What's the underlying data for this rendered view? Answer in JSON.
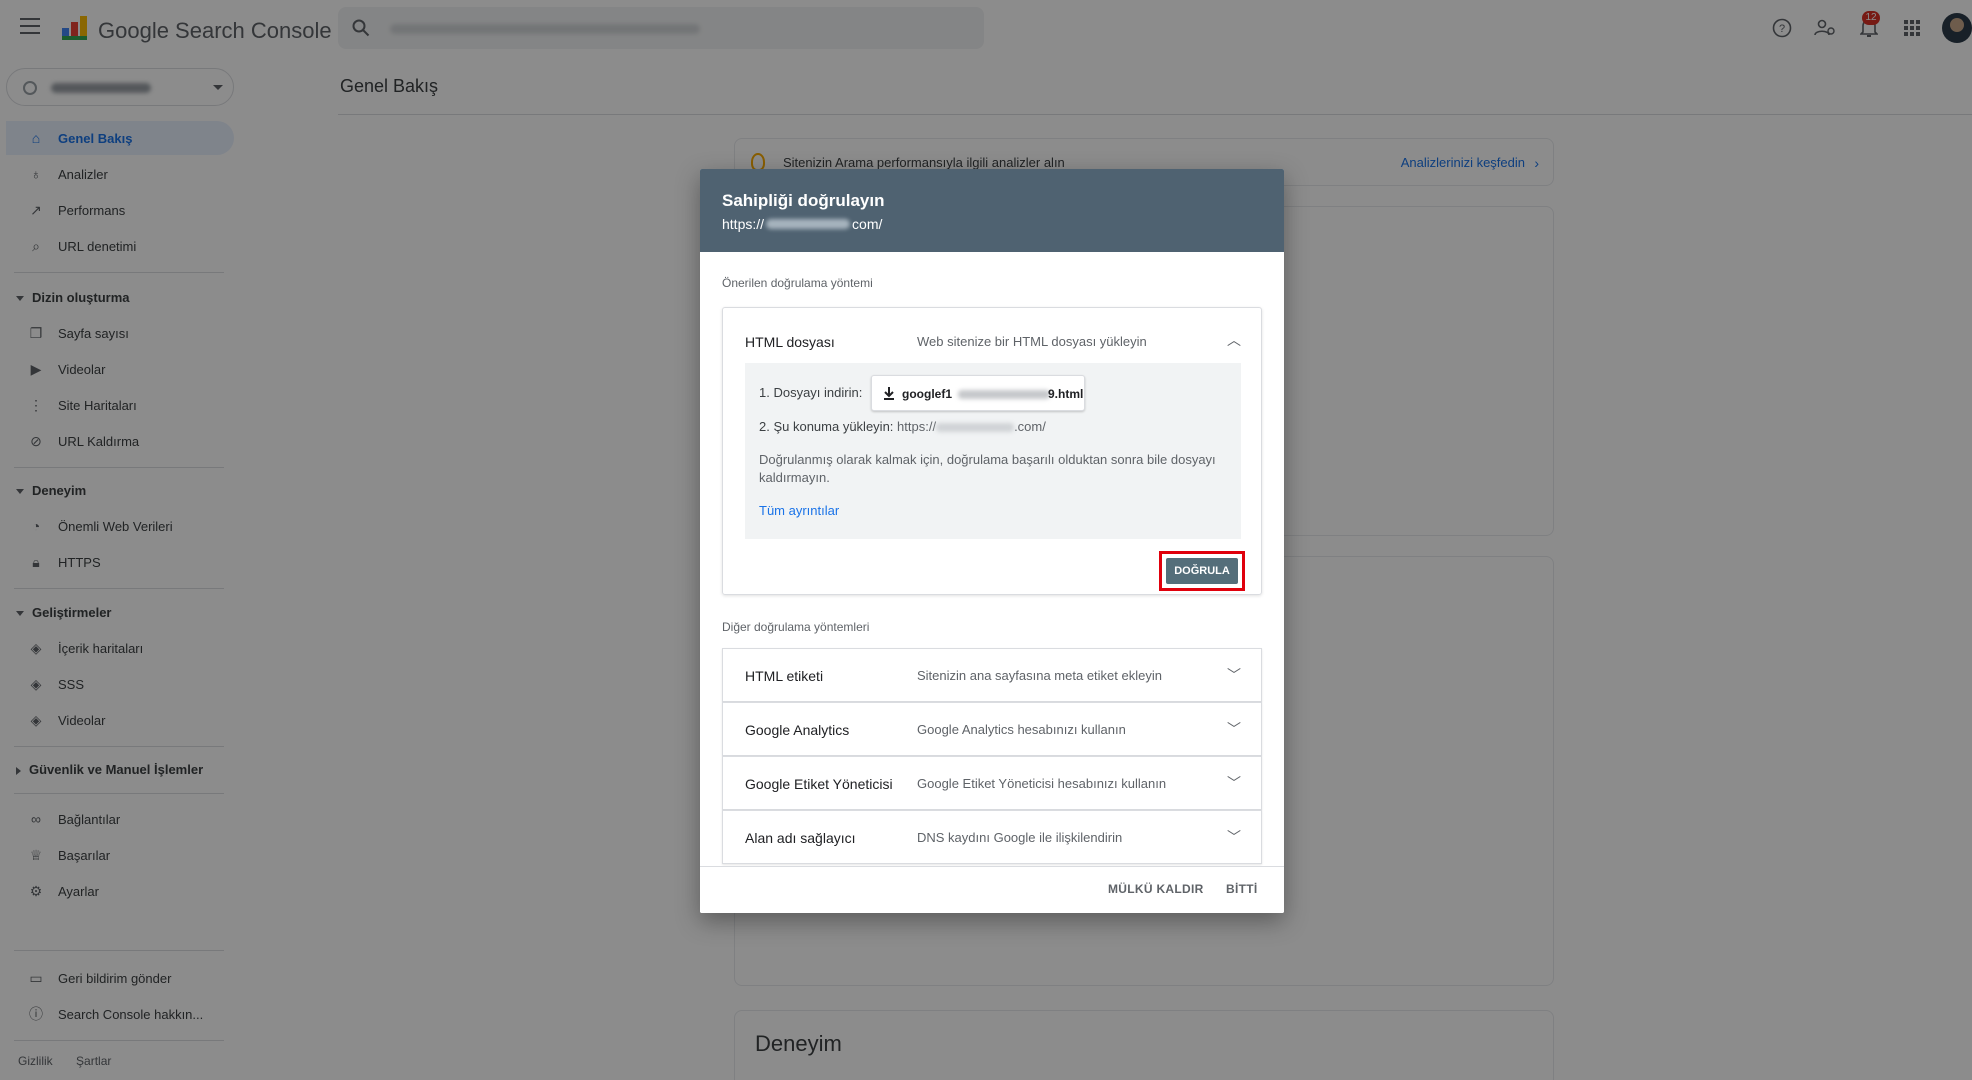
{
  "app": {
    "title": "Google Search Console"
  },
  "search": {
    "placeholder": "",
    "value": ""
  },
  "topbar": {
    "notification_count": "12"
  },
  "sidebar": {
    "items": [
      {
        "label": "Genel Bakış",
        "icon": "home-icon"
      },
      {
        "label": "Analizler",
        "icon": "bulb-icon"
      },
      {
        "label": "Performans",
        "icon": "trend-icon"
      },
      {
        "label": "URL denetimi",
        "icon": "search-icon"
      }
    ],
    "sections": {
      "index": "Dizin oluşturma",
      "experience": "Deneyim",
      "enhancements": "Geliştirmeler",
      "security": "Güvenlik ve Manuel İşlemler"
    },
    "index_items": [
      {
        "label": "Sayfa sayısı"
      },
      {
        "label": "Videolar"
      },
      {
        "label": "Site Haritaları"
      },
      {
        "label": "URL Kaldırma"
      }
    ],
    "experience_items": [
      {
        "label": "Önemli Web Verileri"
      },
      {
        "label": "HTTPS"
      }
    ],
    "enhancement_items": [
      {
        "label": "İçerik haritaları"
      },
      {
        "label": "SSS"
      },
      {
        "label": "Videolar"
      }
    ],
    "misc_items": [
      {
        "label": "Bağlantılar"
      },
      {
        "label": "Başarılar"
      },
      {
        "label": "Ayarlar"
      }
    ],
    "bottom_items": [
      {
        "label": "Geri bildirim gönder"
      },
      {
        "label": "Search Console hakkın..."
      }
    ],
    "footer": {
      "privacy": "Gizlilik",
      "terms": "Şartlar"
    }
  },
  "main": {
    "page_title": "Genel Bakış",
    "insight_text": "Sitenizin Arama performansıyla ilgili analizler alın",
    "insight_link": "Analizlerinizi keşfedin",
    "section_title": "Deneyim"
  },
  "dialog": {
    "title": "Sahipliği doğrulayın",
    "url_prefix": "https://",
    "url_suffix": "com/",
    "recommended_label": "Önerilen doğrulama yöntemi",
    "html_file": {
      "name": "HTML dosyası",
      "desc": "Web sitenize bir HTML dosyası yükleyin",
      "step1": "1. Dosyayı indirin:",
      "file_prefix": "googlef1",
      "file_suffix": "9.html",
      "step2": "2. Şu konuma yükleyin:",
      "upload_prefix": "https://",
      "upload_suffix": ".com/",
      "note": "Doğrulanmış olarak kalmak için, doğrulama başarılı olduktan sonra bile dosyayı kaldırmayın.",
      "details_link": "Tüm ayrıntılar",
      "verify_button": "DOĞRULA"
    },
    "other_label": "Diğer doğrulama yöntemleri",
    "other_methods": [
      {
        "name": "HTML etiketi",
        "desc": "Sitenizin ana sayfasına meta etiket ekleyin"
      },
      {
        "name": "Google Analytics",
        "desc": "Google Analytics hesabınızı kullanın"
      },
      {
        "name": "Google Etiket Yöneticisi",
        "desc": "Google Etiket Yöneticisi hesabınızı kullanın"
      },
      {
        "name": "Alan adı sağlayıcı",
        "desc": "DNS kaydını Google ile ilişkilendirin"
      }
    ],
    "remove_button": "MÜLKÜ KALDIR",
    "done_button": "BİTTİ"
  },
  "colors": {
    "dialog_header": "#4f6271",
    "link": "#1a73e8",
    "verify_button": "#546e7a",
    "highlight_outline": "#e0000c",
    "active_nav": "#e8f0fe"
  }
}
